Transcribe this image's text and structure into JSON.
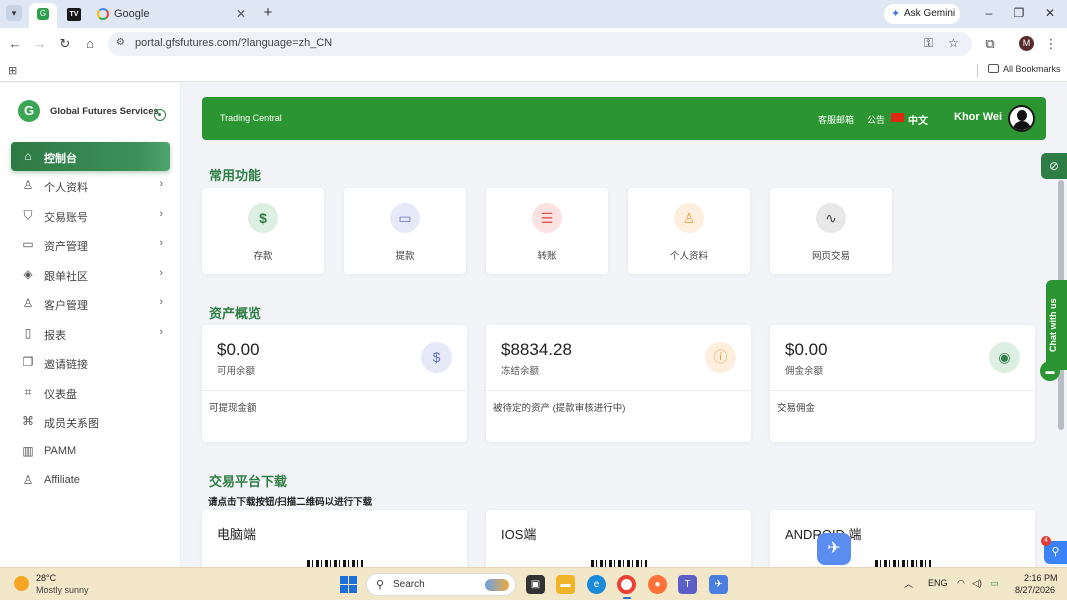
{
  "browser": {
    "tabs": [
      {
        "title": "",
        "favicon": "GFS"
      },
      {
        "title": "",
        "favicon": "TV"
      },
      {
        "title": "Google",
        "favicon": "google-g"
      }
    ],
    "new_tab": "+",
    "ask_gemini": "Ask Gemini",
    "url": "portal.gfsfutures.com/?language=zh_CN",
    "profile_initial": "M",
    "all_bookmarks": "All Bookmarks"
  },
  "sidebar": {
    "logo_letter": "G",
    "brand": "Global Futures Services",
    "items": [
      {
        "label": "控制台",
        "icon": "home-icon",
        "chevron": false,
        "active": true
      },
      {
        "label": "个人资料",
        "icon": "user-icon",
        "chevron": true
      },
      {
        "label": "交易账号",
        "icon": "shield-icon",
        "chevron": true
      },
      {
        "label": "资产管理",
        "icon": "credit-card-icon",
        "chevron": true
      },
      {
        "label": "跟单社区",
        "icon": "layers-icon",
        "chevron": true
      },
      {
        "label": "客户管理",
        "icon": "user-plus-icon",
        "chevron": true
      },
      {
        "label": "报表",
        "icon": "book-icon",
        "chevron": true
      },
      {
        "label": "邀请链接",
        "icon": "copy-icon",
        "chevron": false
      },
      {
        "label": "仪表盘",
        "icon": "crop-icon",
        "chevron": false
      },
      {
        "label": "成员关系图",
        "icon": "command-icon",
        "chevron": false
      },
      {
        "label": "PAMM",
        "icon": "bar-chart-icon",
        "chevron": false
      },
      {
        "label": "Affiliate",
        "icon": "users-icon",
        "chevron": false
      }
    ]
  },
  "header": {
    "title": "Trading Central",
    "support_email": "客服邮箱",
    "announcement": "公告",
    "language": "中文",
    "username": "Khor Wei"
  },
  "quick_actions": {
    "title": "常用功能",
    "items": [
      {
        "label": "存款",
        "icon": "dollar-icon",
        "color": "#2e7d44",
        "bg": "#dcefe1"
      },
      {
        "label": "提款",
        "icon": "card-icon",
        "color": "#6574c4",
        "bg": "#e6e9f7"
      },
      {
        "label": "转账",
        "icon": "server-icon",
        "color": "#e05252",
        "bg": "#fbe2e2"
      },
      {
        "label": "个人资料",
        "icon": "user-icon",
        "color": "#f0a046",
        "bg": "#fdeedd"
      },
      {
        "label": "网页交易",
        "icon": "activity-icon",
        "color": "#444444",
        "bg": "#e8e8e8"
      }
    ]
  },
  "assets": {
    "title": "资产概览",
    "cards": [
      {
        "amount": "$0.00",
        "label": "可用余额",
        "note": "可提现金额",
        "icon": "dollar-icon",
        "color": "#6574c4",
        "bg": "#e6e9f7"
      },
      {
        "amount": "$8834.28",
        "label": "冻结余额",
        "note": "被待定的资产 (提款审核进行中)",
        "icon": "alert-circle-icon",
        "color": "#f0a046",
        "bg": "#fdeedd"
      },
      {
        "amount": "$0.00",
        "label": "佣金余额",
        "note": "交易佣金",
        "icon": "broadcast-icon",
        "color": "#2e7d44",
        "bg": "#dcefe1"
      }
    ]
  },
  "downloads": {
    "title": "交易平台下载",
    "subtitle": "请点击下载按钮/扫描二维码以进行下载",
    "platforms": [
      {
        "label": "电脑端"
      },
      {
        "label": "IOS端"
      },
      {
        "label": "ANDROID 端"
      }
    ]
  },
  "widgets": {
    "chat_label": "Chat with us",
    "badge_count": "4"
  },
  "taskbar": {
    "weather_temp": "28°C",
    "weather_desc": "Mostly sunny",
    "search_label": "Search",
    "language": "ENG",
    "time": "2:16 PM",
    "date": "8/27/2026"
  }
}
